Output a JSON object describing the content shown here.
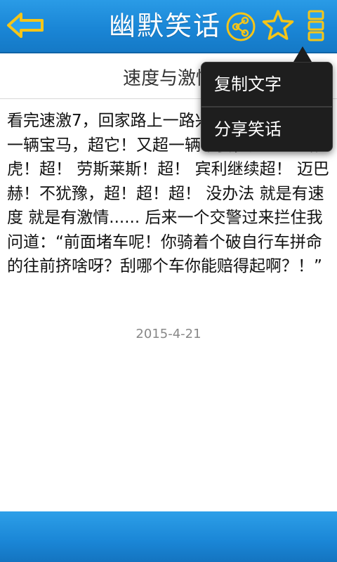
{
  "header": {
    "title": "幽默笑话",
    "back_icon": "back-arrow-icon",
    "share_icon": "share-icon",
    "favorite_icon": "star-icon",
    "menu_icon": "overflow-menu-icon"
  },
  "joke": {
    "title": "速度与激情",
    "body": "看完速激7，回家路上一路兴奋，前方不远处一辆宝马，超它！又超一辆卡宴，超它！ 路虎！超！ 劳斯莱斯！超！ 宾利继续超！ 迈巴赫！不犹豫，超！超！超！ 没办法 就是有速度 就是有激情...... 后来一个交警过来拦住我问道：“前面堵车呢！你骑着个破自行车拼命的往前挤啥呀？刮哪个车你能赔得起啊？！”",
    "date": "2015-4-21"
  },
  "popup_menu": {
    "items": [
      {
        "label": "复制文字"
      },
      {
        "label": "分享笑话"
      }
    ]
  },
  "colors": {
    "header_blue": "#1a86d6",
    "icon_yellow": "#f5c518",
    "back_arrow_fill": "#2aa3f0"
  }
}
